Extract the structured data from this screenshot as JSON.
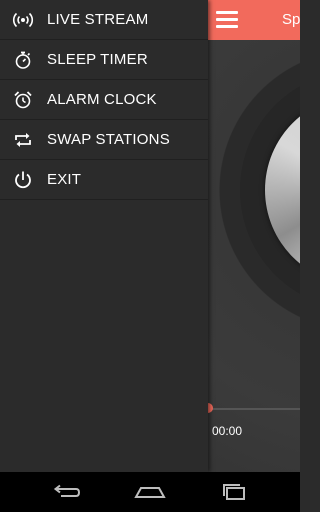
{
  "app": {
    "title": "Sp",
    "elapsed_time": "00:00",
    "accent_color": "#f26a5c"
  },
  "drawer": {
    "items": [
      {
        "label": "LIVE STREAM",
        "icon": "broadcast-icon"
      },
      {
        "label": "SLEEP TIMER",
        "icon": "stopwatch-icon"
      },
      {
        "label": "ALARM CLOCK",
        "icon": "alarm-clock-icon"
      },
      {
        "label": "SWAP STATIONS",
        "icon": "swap-icon"
      },
      {
        "label": "EXIT",
        "icon": "power-icon"
      }
    ]
  },
  "system_nav": {
    "buttons": [
      "back-icon",
      "home-icon",
      "recent-apps-icon"
    ]
  }
}
